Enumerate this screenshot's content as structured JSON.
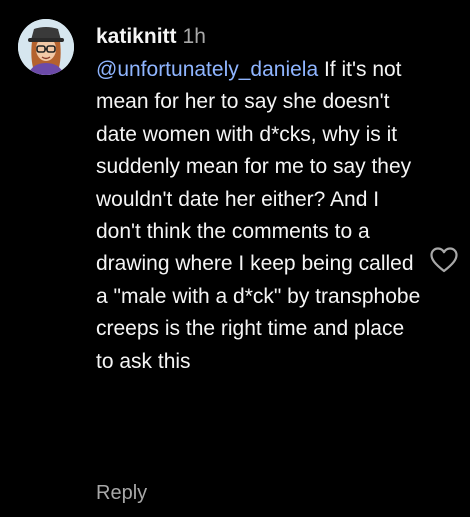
{
  "comment": {
    "username": "katiknitt",
    "timestamp": "1h",
    "mention": "@unfortunately_daniela",
    "text": " If it's not mean for her to say she doesn't date women with d*cks, why is it suddenly mean for me to say they wouldn't date her either? And I don't think the comments to a drawing where I keep being called a \"male with a d*ck\" by transphobe creeps is the right time and place to ask this",
    "reply_label": "Reply",
    "like_icon": "heart-outline-icon",
    "avatar_icon": "cartoon-avatar"
  },
  "colors": {
    "background": "#000000",
    "primary_text": "#f5f5f5",
    "secondary_text": "#a8a8a8",
    "mention": "#8fb5ff",
    "avatar_bg": "#d6e6ef"
  }
}
